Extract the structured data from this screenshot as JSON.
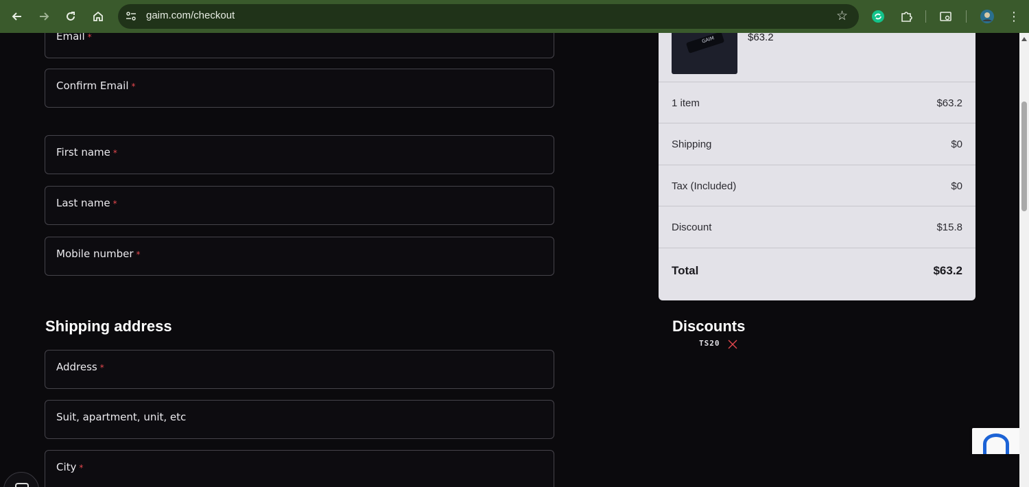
{
  "browser": {
    "url": "gaim.com/checkout"
  },
  "form": {
    "fields": [
      {
        "label": "Email",
        "required": "*"
      },
      {
        "label": "Confirm Email",
        "required": "*"
      },
      {
        "label": "First name",
        "required": "*"
      },
      {
        "label": "Last name",
        "required": "*"
      },
      {
        "label": "Mobile number",
        "required": "*"
      }
    ],
    "shipping_title": "Shipping address",
    "shipping_fields": [
      {
        "label": "Address",
        "required": "*"
      },
      {
        "label": "Suit, apartment, unit, etc",
        "required": ""
      },
      {
        "label": "City",
        "required": "*"
      }
    ]
  },
  "summary": {
    "item_brand": "GAIM",
    "item_price": "$63.2",
    "rows": [
      {
        "label": "1 item",
        "value": "$63.2"
      },
      {
        "label": "Shipping",
        "value": "$0"
      },
      {
        "label": "Tax (Included)",
        "value": "$0"
      },
      {
        "label": "Discount",
        "value": "$15.8"
      }
    ],
    "total_label": "Total",
    "total_value": "$63.2"
  },
  "discounts": {
    "title": "Discounts",
    "code": "TS20"
  },
  "colors": {
    "chrome": "#3a5a2c",
    "background": "#0b0a0d",
    "required": "#e5484d",
    "summary_bg": "#e3e2e8",
    "remove_x": "#e5484d"
  }
}
